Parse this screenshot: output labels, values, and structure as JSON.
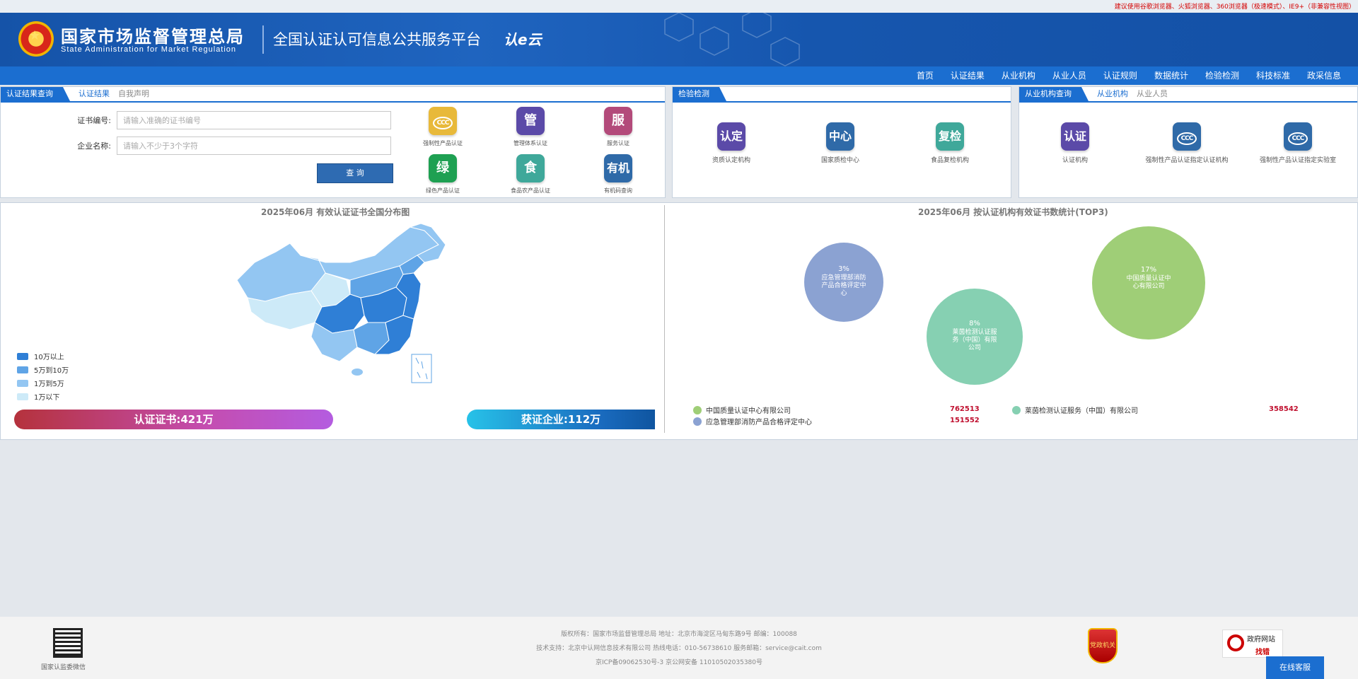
{
  "notice": "建议使用谷歌浏览器、火狐浏览器、360浏览器（极速模式）、IE9+（非兼容性视图）",
  "header": {
    "agency_cn": "国家市场监督管理总局",
    "agency_en": "State Administration for Market Regulation",
    "platform": "全国认证认可信息公共服务平台",
    "brand": "认e云"
  },
  "nav": [
    "首页",
    "认证结果",
    "从业机构",
    "从业人员",
    "认证规则",
    "数据统计",
    "检验检测",
    "科技标准",
    "政采信息"
  ],
  "query_panel": {
    "tabs": [
      "认证结果查询",
      "认证结果",
      "自我声明"
    ],
    "cert_label": "证书编号:",
    "cert_placeholder": "请输入准确的证书编号",
    "company_label": "企业名称:",
    "company_placeholder": "请输入不少于3个字符",
    "button": "查 询",
    "icons": [
      {
        "glyph": "CCC",
        "label": "强制性产品认证",
        "color": "#e8b93a",
        "icon": "ccc-icon"
      },
      {
        "glyph": "管",
        "label": "管理体系认证",
        "color": "#5b4aa8",
        "icon": "management-icon"
      },
      {
        "glyph": "服",
        "label": "服务认证",
        "color": "#b34a7a",
        "icon": "service-icon"
      },
      {
        "glyph": "绿",
        "label": "绿色产品认证",
        "color": "#1ea052",
        "icon": "green-icon"
      },
      {
        "glyph": "食",
        "label": "食品农产品认证",
        "color": "#3fa89a",
        "icon": "food-icon"
      },
      {
        "glyph": "有机",
        "label": "有机码查询",
        "color": "#2f6aa8",
        "icon": "organic-icon"
      }
    ]
  },
  "inspection_panel": {
    "tab": "检验检测",
    "items": [
      {
        "glyph": "认定",
        "label": "资质认定机构",
        "color": "#5b4aa8",
        "icon": "qualification-icon"
      },
      {
        "glyph": "中心",
        "label": "国家质检中心",
        "color": "#2f6aa8",
        "icon": "center-icon"
      },
      {
        "glyph": "复检",
        "label": "食品复检机构",
        "color": "#3fa89a",
        "icon": "recheck-icon"
      }
    ]
  },
  "agency_panel": {
    "tabs": [
      "从业机构查询",
      "从业机构",
      "从业人员"
    ],
    "items": [
      {
        "glyph": "认证",
        "label": "认证机构",
        "color": "#5b4aa8",
        "icon": "cert-body-icon"
      },
      {
        "glyph": "CCC",
        "label": "强制性产品认证指定认证机构",
        "color": "#2f6aa8",
        "icon": "ccc-body-icon"
      },
      {
        "glyph": "CCC",
        "label": "强制性产品认证指定实验室",
        "color": "#2f6aa8",
        "icon": "ccc-lab-icon"
      }
    ]
  },
  "map_section": {
    "title": "2025年06月  有效认证证书全国分布图",
    "legend": [
      {
        "label": "10万以上",
        "color": "#2f7fd6"
      },
      {
        "label": "5万到10万",
        "color": "#5fa4e6"
      },
      {
        "label": "1万到5万",
        "color": "#93c6f2"
      },
      {
        "label": "1万以下",
        "color": "#cdeaf8"
      }
    ],
    "cert_stat": "认证证书:421万",
    "company_stat": "获证企业:112万"
  },
  "chart_data": {
    "type": "bubble",
    "title": "2025年06月   按认证机构有效证书数统计(TOP3)",
    "series": [
      {
        "name": "中国质量认证中心有限公司",
        "value": 762513,
        "percent": "17%",
        "color": "#9fce77",
        "bubble_text": "中国质量认证中心有限公司"
      },
      {
        "name": "莱茵检测认证服务（中国）有限公司",
        "value": 358542,
        "percent": "8%",
        "color": "#86d0b2",
        "bubble_text": "莱茵检测认证服务（中国）有限公司"
      },
      {
        "name": "应急管理部消防产品合格评定中心",
        "value": 151552,
        "percent": "3%",
        "color": "#8ba2d2",
        "bubble_text": "应急管理部消防产品合格评定中心"
      }
    ]
  },
  "footer": {
    "line1": "版权所有：国家市场监督管理总局    地址：北京市海淀区马甸东路9号    邮编：100088",
    "line2": "技术支持：北京中认网信息技术有限公司    热线电话：010-56738610    服务邮箱：service@cait.com",
    "line3": "京ICP备09062530号-3    京公网安备 11010502035380号",
    "qr_label": "国家认监委微信",
    "badge": "党政机关",
    "gov_site_1": "政府网站",
    "gov_site_2": "找错",
    "chat": "在线客服"
  }
}
